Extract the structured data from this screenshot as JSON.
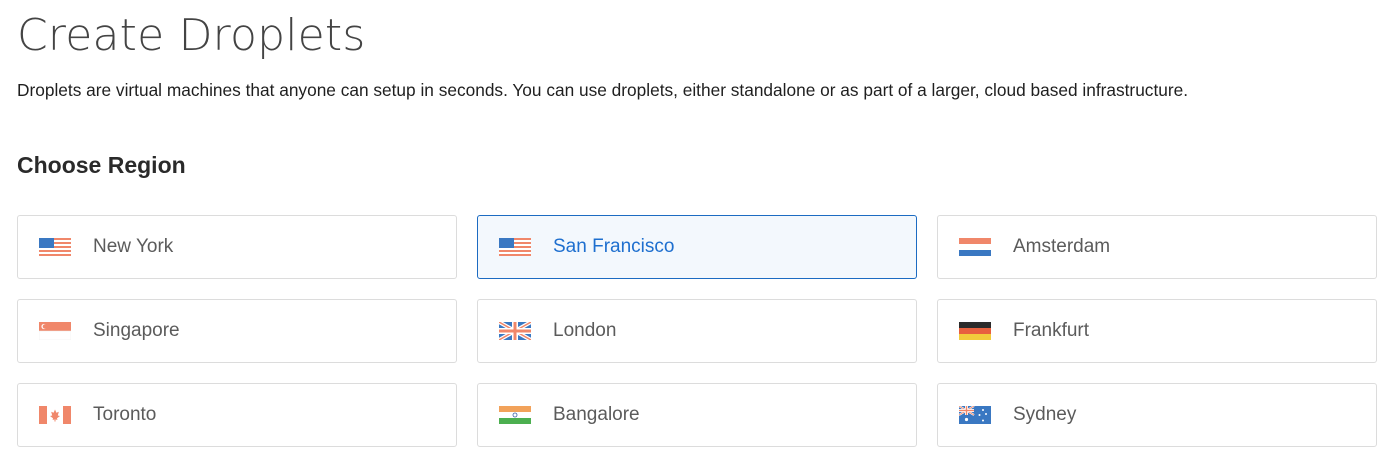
{
  "page": {
    "title": "Create Droplets",
    "description": "Droplets are virtual machines that anyone can setup in seconds. You can use droplets, either standalone or as part of a larger, cloud based infrastructure."
  },
  "region_section": {
    "title": "Choose Region",
    "selected": "San Francisco",
    "regions": [
      {
        "label": "New York",
        "flag": "us-flag-icon"
      },
      {
        "label": "San Francisco",
        "flag": "us-flag-icon"
      },
      {
        "label": "Amsterdam",
        "flag": "netherlands-flag-icon"
      },
      {
        "label": "Singapore",
        "flag": "singapore-flag-icon"
      },
      {
        "label": "London",
        "flag": "uk-flag-icon"
      },
      {
        "label": "Frankfurt",
        "flag": "germany-flag-icon"
      },
      {
        "label": "Toronto",
        "flag": "canada-flag-icon"
      },
      {
        "label": "Bangalore",
        "flag": "india-flag-icon"
      },
      {
        "label": "Sydney",
        "flag": "australia-flag-icon"
      }
    ]
  },
  "colors": {
    "selected_border": "#1c6bc2",
    "selected_text": "#1e6fcf",
    "selected_background": "#f3f8fd",
    "card_border": "#dcdcdc"
  }
}
